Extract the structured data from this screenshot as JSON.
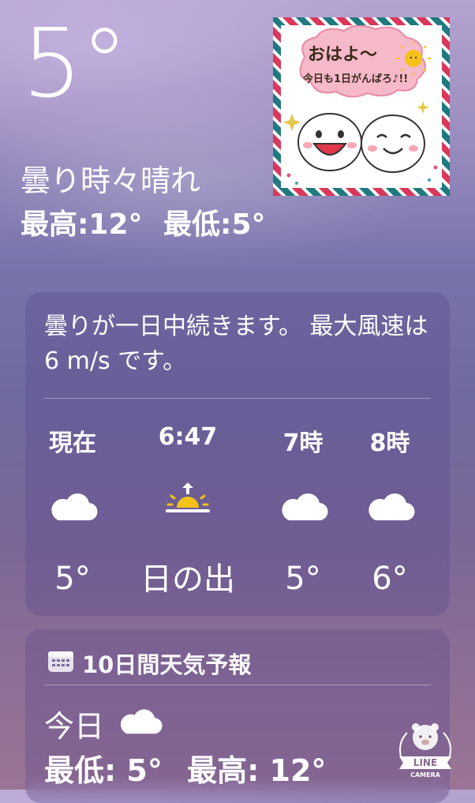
{
  "current": {
    "temperature": "5°",
    "condition": "曇り時々晴れ",
    "low_label": "最低:5°",
    "high_label": "最高:12°"
  },
  "sticker": {
    "line1": "おはよ〜",
    "line2": "今日も1日がんばろ♪!!"
  },
  "hourly": {
    "summary": "曇りが一日中続きます。 最大風速は 6 m/s です。",
    "items": [
      {
        "time": "現在",
        "icon": "cloud-icon",
        "value": "5°"
      },
      {
        "time": "6:47",
        "icon": "sunrise-icon",
        "value": "日の出"
      },
      {
        "time": "7時",
        "icon": "cloud-icon",
        "value": "5°"
      },
      {
        "time": "8時",
        "icon": "cloud-icon",
        "value": "6°"
      }
    ]
  },
  "forecast": {
    "title": "10日間天気予報",
    "today_label": "今日",
    "today_icon": "cloud-icon",
    "today_low": "最低: 5°",
    "today_high": "最高: 12°"
  },
  "watermark": {
    "brand": "LINE",
    "sub": "CAMERA"
  },
  "colors": {
    "sun_yellow": "#f5c21b",
    "sticker_red": "#d9385a",
    "sticker_teal": "#1f7a80"
  }
}
